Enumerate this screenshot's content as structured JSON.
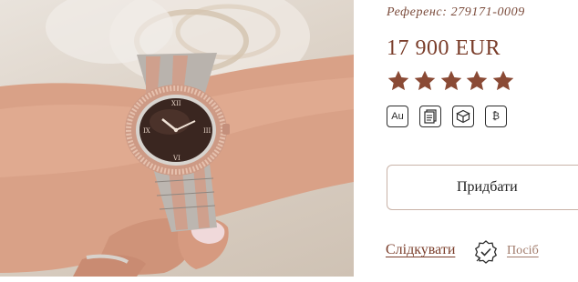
{
  "product": {
    "reference": "Референс: 279171-0009",
    "price": "17 900 EUR",
    "rating": 5,
    "accent_color": "#8a4a35"
  },
  "badges": [
    {
      "icon": "gold-au-badge-icon",
      "label": "Au"
    },
    {
      "icon": "documents-icon"
    },
    {
      "icon": "box-icon"
    },
    {
      "icon": "bitcoin-icon",
      "label": "₿"
    }
  ],
  "actions": {
    "buy_label": "Придбати",
    "follow_label": "Слідкувати",
    "more_label": "Посіб"
  }
}
